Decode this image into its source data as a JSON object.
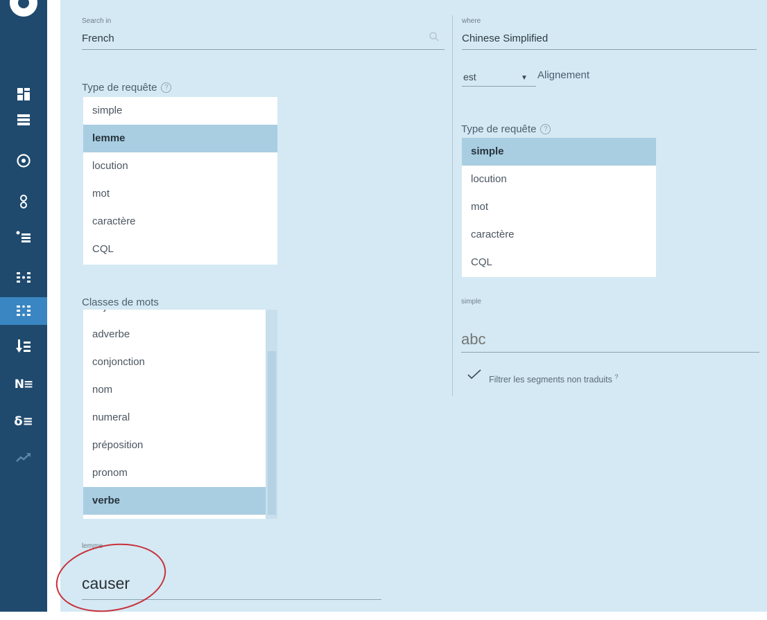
{
  "sidebar": {
    "items": [
      {
        "name": "dashboard-icon",
        "glyph": ""
      },
      {
        "name": "list-icon",
        "glyph": ""
      },
      {
        "name": "target-icon",
        "glyph": ""
      },
      {
        "name": "rings-icon",
        "glyph": ""
      },
      {
        "name": "bullet-list-icon",
        "glyph": ""
      },
      {
        "name": "align-list-icon",
        "glyph": ""
      },
      {
        "name": "parallel-list-icon",
        "glyph": "",
        "active": true
      },
      {
        "name": "sort-down-list-icon",
        "glyph": ""
      },
      {
        "name": "n-list-label",
        "glyph": "N≡"
      },
      {
        "name": "delta-list-label",
        "glyph": "δ≡"
      },
      {
        "name": "trend-icon",
        "glyph": ""
      }
    ]
  },
  "left": {
    "search_label": "Search in",
    "search_value": "French",
    "query_type_title": "Type de requête",
    "query_types": [
      "simple",
      "lemme",
      "locution",
      "mot",
      "caractère",
      "CQL"
    ],
    "query_type_selected": "lemme",
    "word_classes_title": "Classes de mots",
    "word_classes": [
      "adjectif",
      "adverbe",
      "conjonction",
      "nom",
      "numeral",
      "préposition",
      "pronom",
      "verbe"
    ],
    "word_class_selected": "verbe",
    "lemma_label": "lemme",
    "lemma_value": "causer"
  },
  "right": {
    "where_label": "where",
    "where_value": "Chinese Simplified",
    "align_select_value": "est",
    "align_label": "Alignement",
    "query_type_title": "Type de requête",
    "query_types": [
      "simple",
      "locution",
      "mot",
      "caractère",
      "CQL"
    ],
    "query_type_selected": "simple",
    "simple_label": "simple",
    "simple_placeholder": "abc",
    "filter_label": "Filtrer les segments non traduits",
    "filter_help": "?"
  },
  "colors": {
    "sidebar": "#1f4a6e",
    "sidebar_active": "#3a86c2",
    "panel": "#d4e9f3",
    "selected_row": "#a9cde1",
    "annotation": "#c8303a"
  }
}
